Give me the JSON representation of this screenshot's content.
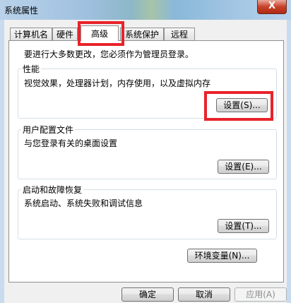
{
  "window": {
    "title": "系统属性",
    "close_glyph": "X"
  },
  "tabs": [
    {
      "label": "计算机名",
      "selected": false
    },
    {
      "label": "硬件",
      "selected": false
    },
    {
      "label": "高级",
      "selected": true
    },
    {
      "label": "系统保护",
      "selected": false
    },
    {
      "label": "远程",
      "selected": false
    }
  ],
  "intro": "要进行大多数更改，您必须作为管理员登录。",
  "performance": {
    "title": "性能",
    "description": "视觉效果，处理器计划，内存使用，以及虚拟内存",
    "button": "设置(S)..."
  },
  "profiles": {
    "title": "用户配置文件",
    "description": "与您登录有关的桌面设置",
    "button": "设置(E)..."
  },
  "startup": {
    "title": "启动和故障恢复",
    "description": "系统启动、系统失败和调试信息",
    "button": "设置(T)..."
  },
  "env_button": "环境变量(N)...",
  "footer": {
    "ok": "确定",
    "cancel": "取消",
    "apply": "应用(A)"
  },
  "highlight_color": "#e8232a"
}
